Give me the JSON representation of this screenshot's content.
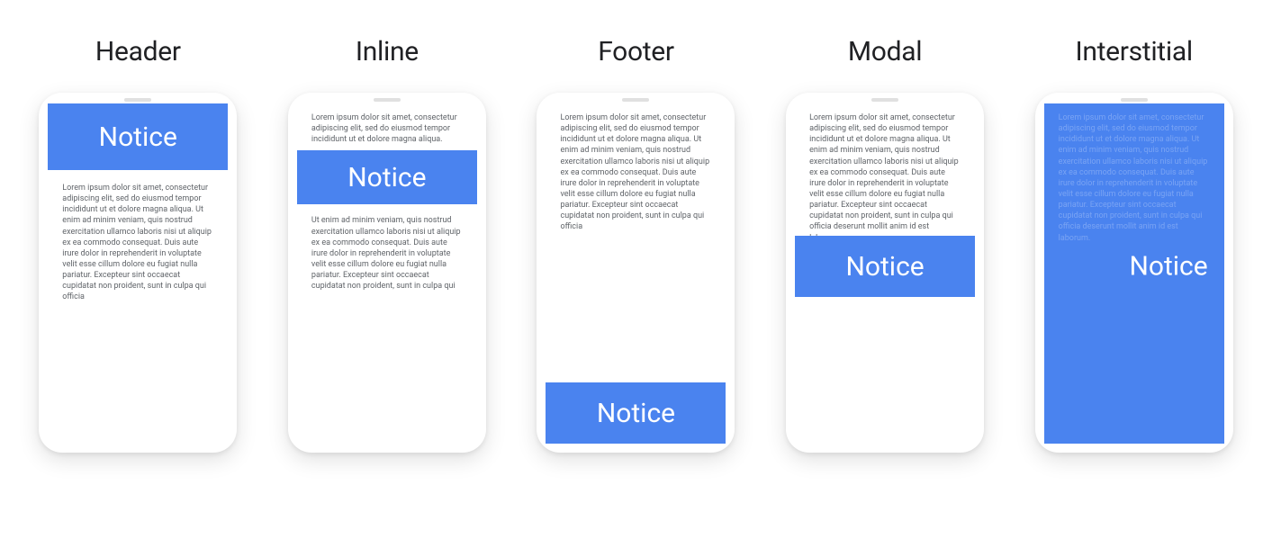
{
  "notice_label": "Notice",
  "lorem_short": "Lorem ipsum dolor sit amet, consectetur adipiscing elit, sed do eiusmod tempor incididunt ut et dolore magna aliqua.",
  "lorem_mid": "Ut enim ad minim veniam, quis nostrud exercitation ullamco laboris nisi ut aliquip ex ea commodo consequat. Duis aute irure dolor in reprehenderit in voluptate velit esse cillum dolore eu fugiat nulla pariatur. Excepteur sint occaecat cupidatat non proident, sunt in culpa qui",
  "lorem_long": "Lorem ipsum dolor sit amet, consectetur adipiscing elit, sed do eiusmod tempor incididunt ut et dolore magna aliqua. Ut enim ad minim veniam, quis nostrud exercitation ullamco laboris nisi ut aliquip ex ea commodo consequat. Duis aute irure dolor in reprehenderit in voluptate velit esse cillum dolore eu fugiat nulla pariatur. Excepteur sint occaecat cupidatat non proident, sunt in culpa qui officia",
  "lorem_full": "Lorem ipsum dolor sit amet, consectetur adipiscing elit, sed do eiusmod tempor incididunt ut et dolore magna aliqua. Ut enim ad minim veniam, quis nostrud exercitation ullamco laboris nisi ut aliquip ex ea commodo consequat. Duis aute irure dolor in reprehenderit in voluptate velit esse cillum dolore eu fugiat nulla pariatur. Excepteur sint occaecat cupidatat non proident, sunt in culpa qui officia deserunt mollit anim id est laborum.",
  "variants": {
    "0": {
      "title": "Header"
    },
    "1": {
      "title": "Inline"
    },
    "2": {
      "title": "Footer"
    },
    "3": {
      "title": "Modal"
    },
    "4": {
      "title": "Interstitial"
    }
  },
  "colors": {
    "notice_bg": "#4a83ef",
    "text": "#5f6368",
    "title": "#202124"
  }
}
